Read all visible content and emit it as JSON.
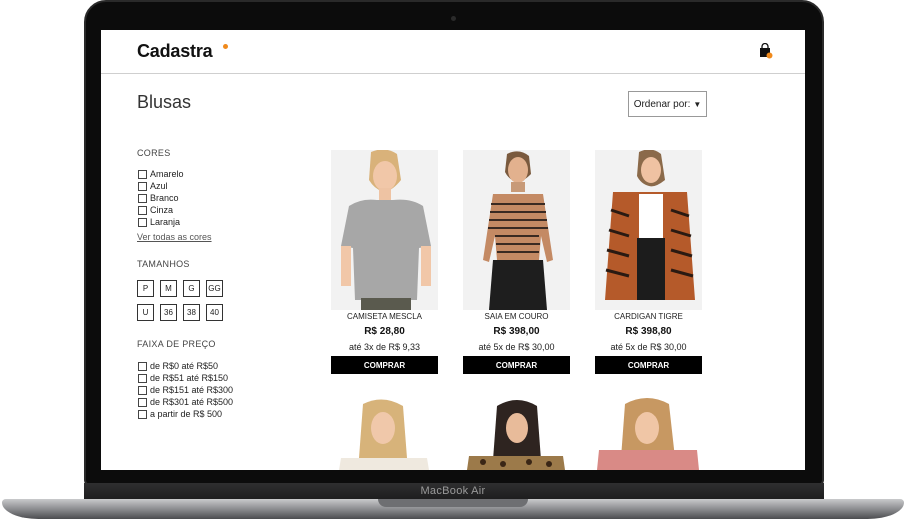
{
  "device": {
    "label": "MacBook Air"
  },
  "header": {
    "logo": "Cadastra",
    "accent": "#f08a1c",
    "cart_icon": "shopping-bag-icon"
  },
  "page": {
    "title": "Blusas",
    "sort_label": "Ordenar por:",
    "sort_arrow": "▼"
  },
  "filters": {
    "colors": {
      "title": "CORES",
      "options": [
        "Amarelo",
        "Azul",
        "Branco",
        "Cinza",
        "Laranja"
      ],
      "see_all": "Ver todas as cores"
    },
    "sizes": {
      "title": "TAMANHOS",
      "row1": [
        "P",
        "M",
        "G",
        "GG"
      ],
      "row2": [
        "U",
        "36",
        "38",
        "40"
      ]
    },
    "price": {
      "title": "FAIXA DE PREÇO",
      "options": [
        "de R$0 até R$50",
        "de R$51 até R$150",
        "de R$151 até R$300",
        "de R$301 até R$500",
        "a partir de R$ 500"
      ]
    }
  },
  "products": [
    {
      "name": "CAMISETA MESCLA",
      "price": "R$ 28,80",
      "installments": "até 3x de R$ 9,33",
      "buy": "COMPRAR"
    },
    {
      "name": "SAIA EM COURO",
      "price": "R$ 398,00",
      "installments": "até 5x de R$ 30,00",
      "buy": "COMPRAR"
    },
    {
      "name": "CARDIGAN TIGRE",
      "price": "R$ 398,80",
      "installments": "até 5x de R$ 30,00",
      "buy": "COMPRAR"
    }
  ]
}
